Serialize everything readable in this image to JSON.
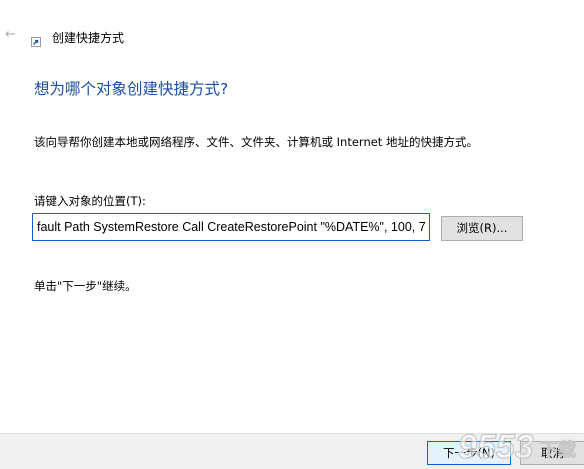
{
  "window": {
    "title": "创建快捷方式"
  },
  "main": {
    "heading": "想为哪个对象创建快捷方式?",
    "description": "该向导帮你创建本地或网络程序、文件、文件夹、计算机或 Internet 地址的快捷方式。",
    "location_label": "请键入对象的位置(T):",
    "location_value": "fault Path SystemRestore Call CreateRestorePoint \"%DATE%\", 100, 7",
    "browse_label": "浏览(R)...",
    "continue_text": "单击\"下一步\"继续。"
  },
  "footer": {
    "next_label": "下一步(N)",
    "cancel_label": "取消"
  },
  "watermark": {
    "number": "9553",
    "suffix": "下载"
  },
  "colors": {
    "heading": "#1b4fa8",
    "focus_border": "#0a64c8",
    "footer_bg": "#f0f0f0",
    "button_bg": "#e1e1e1"
  },
  "icons": {
    "back": "back-arrow-icon",
    "wizard": "shortcut-wizard-icon"
  }
}
